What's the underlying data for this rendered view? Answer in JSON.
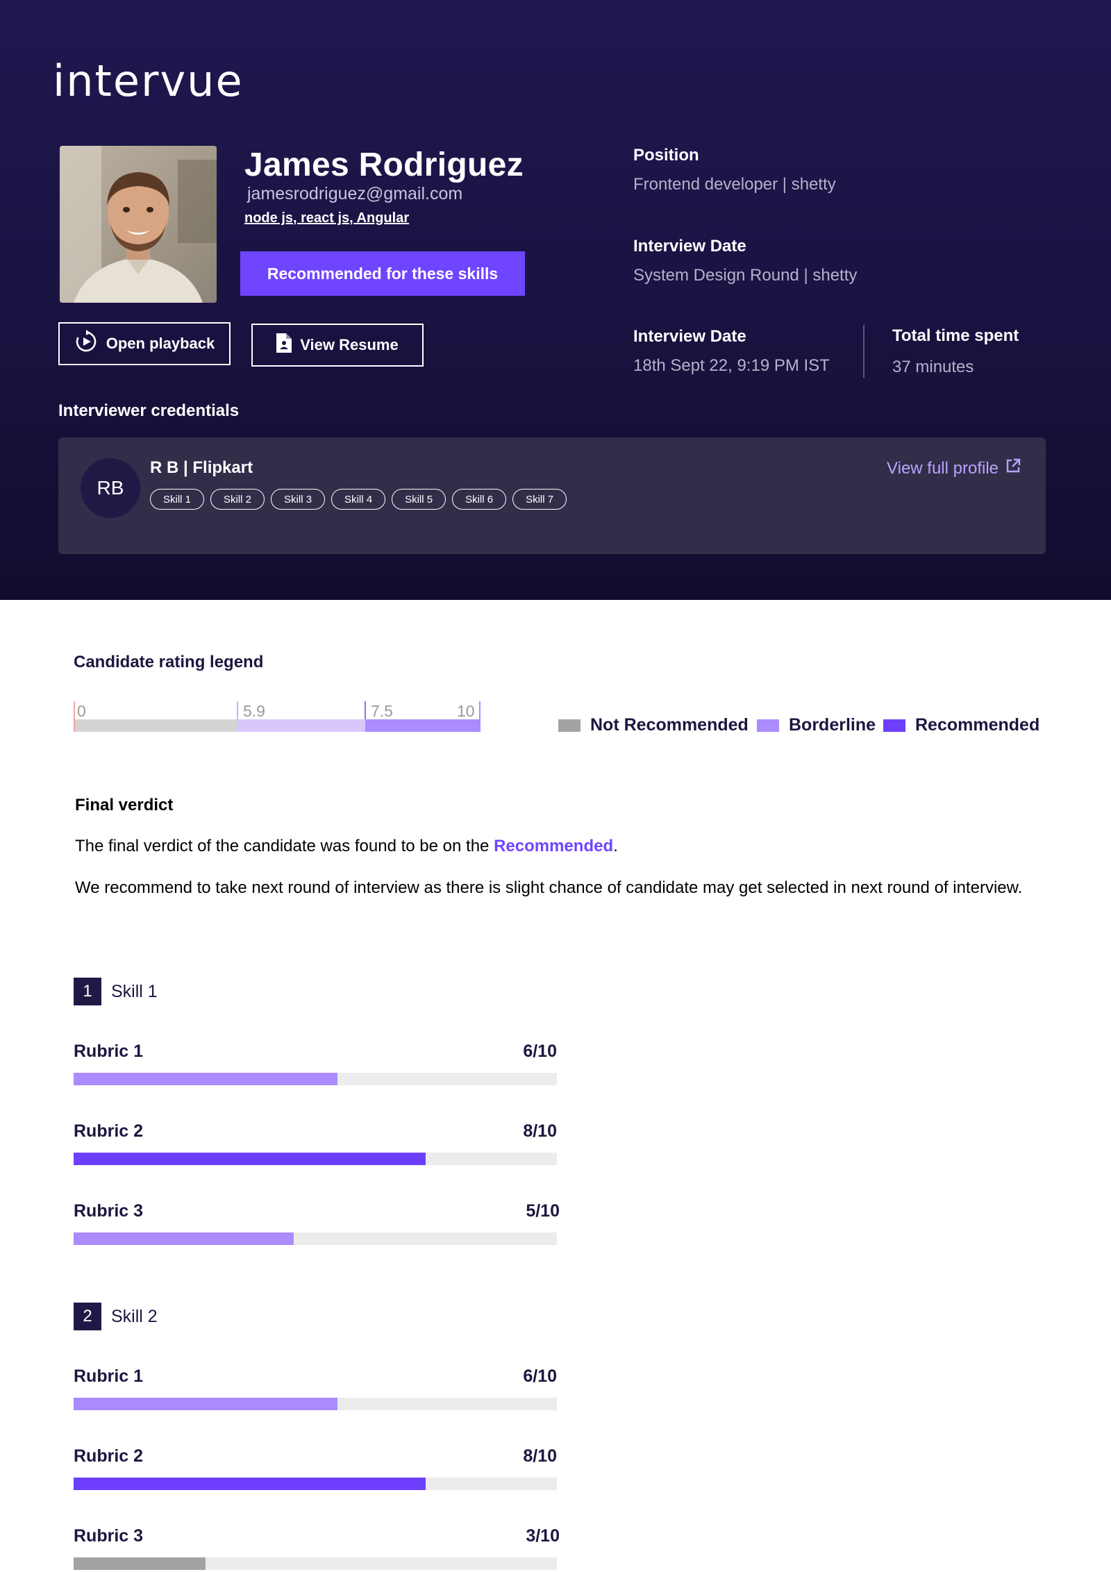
{
  "brand": {
    "logo_text": "intervue"
  },
  "candidate": {
    "name": "James Rodriguez",
    "email": "jamesrodriguez@gmail.com",
    "skills": "node js, react js, Angular",
    "recommend_label": "Recommended for these skills",
    "playback_label": "Open playback",
    "resume_label": "View Resume"
  },
  "meta": {
    "position_label": "Position",
    "position_value": "Frontend developer | shetty",
    "round_label": "Interview Date",
    "round_value": "System Design Round | shetty",
    "date_label": "Interview Date",
    "date_value": "18th Sept 22, 9:19 PM IST",
    "time_label": "Total time spent",
    "time_value": "37 minutes"
  },
  "interviewer": {
    "section_title": "Interviewer credentials",
    "initials": "RB",
    "name": "R B | Flipkart",
    "skills": [
      "Skill 1",
      "Skill 2",
      "Skill 3",
      "Skill 4",
      "Skill 5",
      "Skill 6",
      "Skill 7"
    ],
    "profile_link": "View full profile"
  },
  "legend": {
    "title": "Candidate rating legend",
    "ticks": [
      "0",
      "5.9",
      "7.5",
      "10"
    ],
    "tick_values": [
      0,
      5.9,
      7.5,
      10
    ],
    "items": [
      {
        "label": "Not Recommended",
        "color": "#a3a3a3"
      },
      {
        "label": "Borderline",
        "color": "#ab8bfd"
      },
      {
        "label": "Recommended",
        "color": "#6d3ffc"
      }
    ]
  },
  "verdict": {
    "title": "Final verdict",
    "line1_prefix": "The final verdict of the candidate was found to be on the ",
    "line1_highlight": "Recommended",
    "line1_suffix": ".",
    "line2": "We recommend to take next round of interview as there is slight chance of candidate may get selected  in next round of interview."
  },
  "skills": [
    {
      "number": "1",
      "name": "Skill 1",
      "rubrics": [
        {
          "label": "Rubric 1",
          "score_text": "6/10",
          "score": 6,
          "max": 10,
          "color": "#ab8bfd"
        },
        {
          "label": "Rubric 2",
          "score_text": "8/10",
          "score": 8,
          "max": 10,
          "color": "#6d3ffc"
        },
        {
          "label": "Rubric 3",
          "score_text": "5/10",
          "score": 5,
          "max": 10,
          "color": "#ab8bfd"
        }
      ]
    },
    {
      "number": "2",
      "name": "Skill 2",
      "rubrics": [
        {
          "label": "Rubric 1",
          "score_text": "6/10",
          "score": 6,
          "max": 10,
          "color": "#ab8bfd"
        },
        {
          "label": "Rubric 2",
          "score_text": "8/10",
          "score": 8,
          "max": 10,
          "color": "#6d3ffc"
        },
        {
          "label": "Rubric 3",
          "score_text": "3/10",
          "score": 3,
          "max": 10,
          "color": "#a3a3a3"
        }
      ]
    }
  ]
}
